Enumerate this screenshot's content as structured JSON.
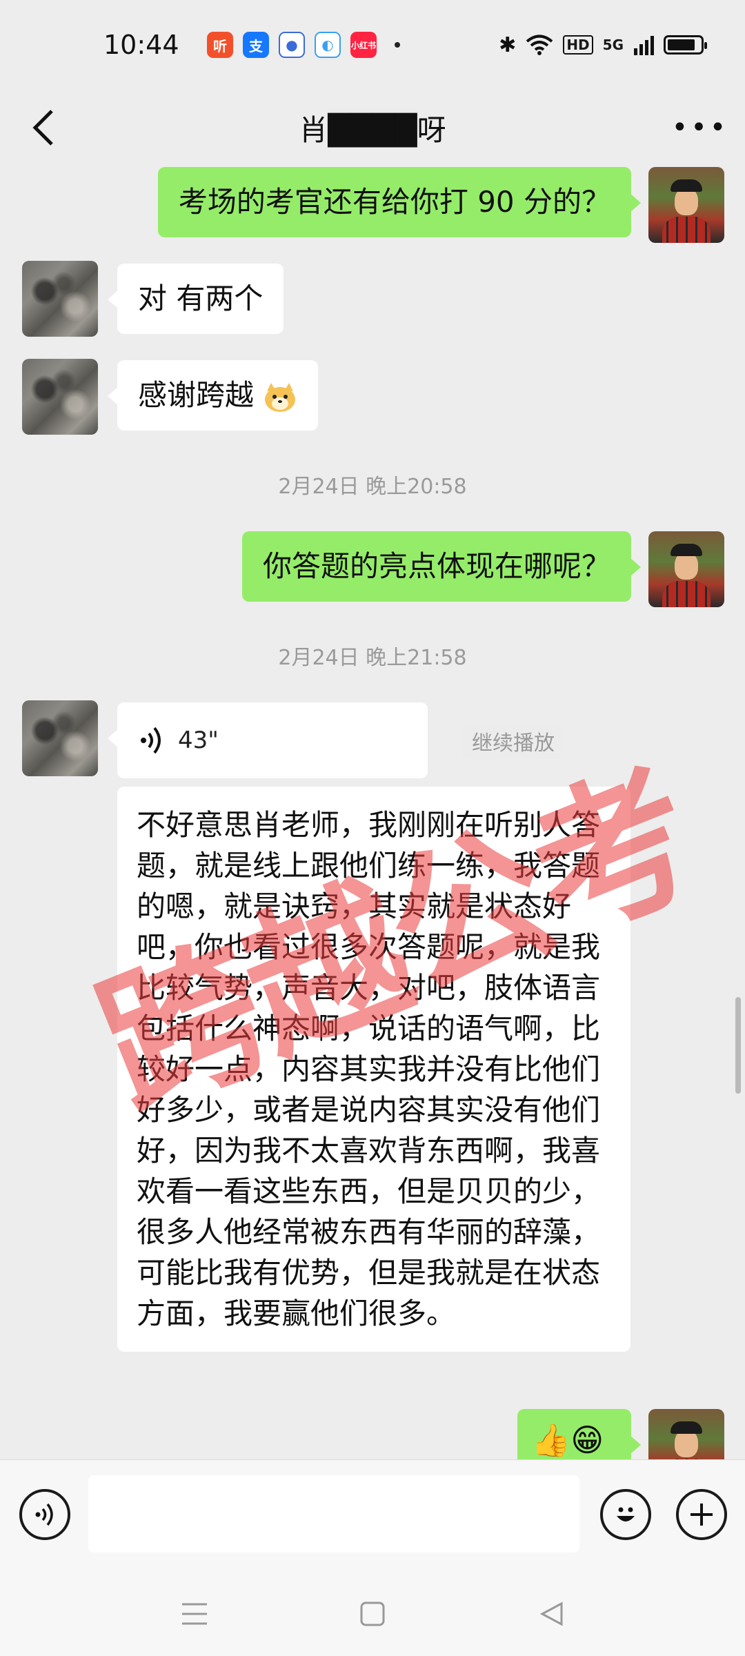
{
  "status_bar": {
    "time": "10:44",
    "apps": [
      {
        "name": "ting-app-icon",
        "label": "听",
        "color": "#f2502b"
      },
      {
        "name": "alipay-icon",
        "label": "支",
        "color": "#1677ff"
      },
      {
        "name": "baidu-icon",
        "label": "",
        "color": "#3a6bd9"
      },
      {
        "name": "browser-icon",
        "label": "",
        "color": "#3aa0f0"
      },
      {
        "name": "xiaohongshu-icon",
        "label": "小红书",
        "color": "#ff2442"
      }
    ],
    "network": "5G",
    "hd_label": "HD",
    "battery_level": 0.85
  },
  "header": {
    "title": "肖████呀"
  },
  "messages": {
    "m1": "考场的考官还有给你打 90 分的？",
    "m2": "对 有两个",
    "m3": "感谢跨越",
    "ts1": "2月24日 晚上20:58",
    "m4": "你答题的亮点体现在哪呢？",
    "ts2": "2月24日 晚上21:58",
    "voice_duration": "43\"",
    "continue_play": "继续播放",
    "transcript": "不好意思肖老师，我刚刚在听别人答题，就是线上跟他们练一练，我答题的嗯，就是诀窍，其实就是状态好吧，你也看过很多次答题呢，就是我比较气势，声音大，对吧，肢体语言包括什么神态啊，说话的语气啊，比较好一点，内容其实我并没有比他们好多少，或者是说内容其实没有他们好，因为我不太喜欢背东西啊，我喜欢看一看这些东西，但是贝贝的少，很多人他经常被东西有华丽的辞藻，可能比我有优势，但是我就是在状态方面，我要赢他们很多。",
    "m6_emoji": "👍😁"
  },
  "watermark": "跨越公考",
  "input": {
    "placeholder": ""
  }
}
